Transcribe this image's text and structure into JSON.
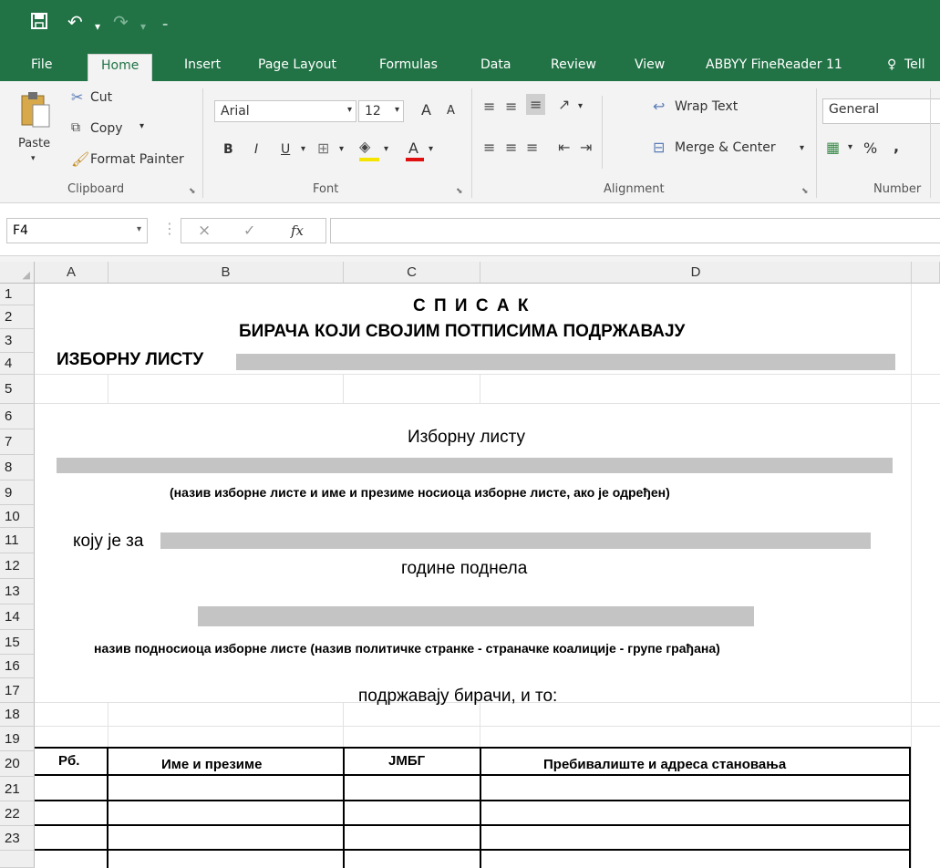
{
  "qat": {
    "save_icon": "save-icon",
    "undo_icon": "undo-icon",
    "redo_icon": "redo-icon",
    "customize_icon": "customize-qat-icon"
  },
  "tabs": [
    "File",
    "Home",
    "Insert",
    "Page Layout",
    "Formulas",
    "Data",
    "Review",
    "View",
    "ABBYY FineReader 11",
    "Tell"
  ],
  "ribbon": {
    "clipboard": {
      "paste": "Paste",
      "cut": "Cut",
      "copy": "Copy",
      "format_painter": "Format Painter",
      "label": "Clipboard"
    },
    "font": {
      "name": "Arial",
      "size": "12",
      "bold": "B",
      "italic": "I",
      "underline": "U",
      "grow": "A",
      "shrink": "A",
      "font_color": "A",
      "label": "Font"
    },
    "alignment": {
      "wrap_text": "Wrap Text",
      "merge_center": "Merge & Center",
      "label": "Alignment"
    },
    "number": {
      "format": "General",
      "percent": "%",
      "comma": ",",
      "label": "Number"
    }
  },
  "formula_bar": {
    "name_box": "F4",
    "fx": "fx",
    "cancel": "×",
    "enter": "✓",
    "value": ""
  },
  "columns": [
    "A",
    "B",
    "C",
    "D"
  ],
  "rows": [
    "1",
    "2",
    "3",
    "4",
    "5",
    "6",
    "7",
    "8",
    "9",
    "10",
    "11",
    "12",
    "13",
    "14",
    "15",
    "16",
    "17",
    "18",
    "19",
    "20",
    "21",
    "22",
    "23"
  ],
  "sheet": {
    "title": "С П И С А К",
    "subtitle": "БИРАЧА КОЈИ СВОЈИМ ПОТПИСИМА ПОДРЖАВАЈУ",
    "list_label": "ИЗБОРНУ ЛИСТУ",
    "to_list": "Изборну листу",
    "list_name_note": "(назив изборне листе и име и презиме носиоца изборне листе, ако је одређен)",
    "which_for": "коју је за",
    "year_submitted": "године поднела",
    "submitter_note": "назив подносиоца изборне листе (назив политичке странке - страначке коалиције - групе грађана)",
    "supported_by": "подржавају бирачи, и то:",
    "table_headers": [
      "Рб.",
      "Име и презиме",
      "ЈМБГ",
      "Пребивалиште и адреса становања"
    ]
  },
  "colors": {
    "excel_green": "#217346",
    "ribbon_bg": "#f3f3f3",
    "redaction": "#c4c4c4"
  }
}
